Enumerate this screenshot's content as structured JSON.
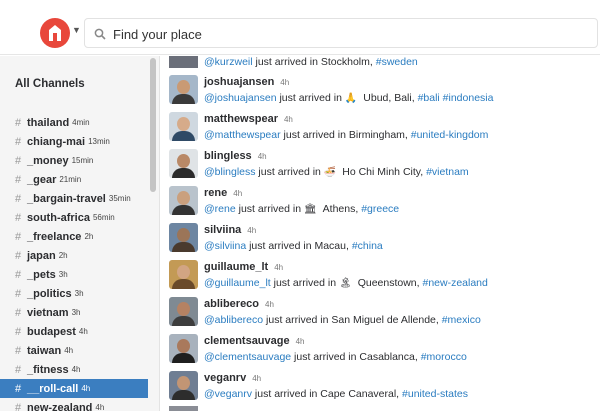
{
  "search": {
    "placeholder": "Find your place"
  },
  "sidebar": {
    "title": "All Channels",
    "channels": [
      {
        "name": "thailand",
        "time": "4min"
      },
      {
        "name": "chiang-mai",
        "time": "13min"
      },
      {
        "name": "_money",
        "time": "15min"
      },
      {
        "name": "_gear",
        "time": "21min"
      },
      {
        "name": "_bargain-travel",
        "time": "35min"
      },
      {
        "name": "south-africa",
        "time": "56min"
      },
      {
        "name": "_freelance",
        "time": "2h"
      },
      {
        "name": "japan",
        "time": "2h"
      },
      {
        "name": "_pets",
        "time": "3h"
      },
      {
        "name": "_politics",
        "time": "3h"
      },
      {
        "name": "vietnam",
        "time": "3h"
      },
      {
        "name": "budapest",
        "time": "4h"
      },
      {
        "name": "taiwan",
        "time": "4h"
      },
      {
        "name": "_fitness",
        "time": "4h"
      },
      {
        "name": "__roll-call",
        "time": "4h",
        "active": true
      },
      {
        "name": "new-zealand",
        "time": "4h"
      }
    ]
  },
  "feed": {
    "partial": {
      "mention": "@kurzweil",
      "text": " just arrived in Stockholm, ",
      "tag": "#sweden"
    },
    "messages": [
      {
        "user": "joshuajansen",
        "ago": "4h",
        "mention": "@joshuajansen",
        "text1": " just arrived in ",
        "emoji": "🙏",
        "place": "Ubud, Bali, ",
        "tags": "#bali #indonesia"
      },
      {
        "user": "matthewspear",
        "ago": "4h",
        "mention": "@matthewspear",
        "text1": " just arrived in ",
        "emoji": "",
        "place": "Birmingham, ",
        "tags": "#united-kingdom"
      },
      {
        "user": "blingless",
        "ago": "4h",
        "mention": "@blingless",
        "text1": " just arrived in ",
        "emoji": "🍜",
        "place": "Ho Chi Minh City, ",
        "tags": "#vietnam"
      },
      {
        "user": "rene",
        "ago": "4h",
        "mention": "@rene",
        "text1": " just arrived in ",
        "emoji": "🏛",
        "place": "Athens, ",
        "tags": "#greece"
      },
      {
        "user": "silviina",
        "ago": "4h",
        "mention": "@silviina",
        "text1": " just arrived in ",
        "emoji": "",
        "place": "Macau, ",
        "tags": "#china"
      },
      {
        "user": "guillaume_lt",
        "ago": "4h",
        "mention": "@guillaume_lt",
        "text1": " just arrived in ",
        "emoji": "🏝",
        "place": "Queenstown, ",
        "tags": "#new-zealand"
      },
      {
        "user": "ablibereco",
        "ago": "4h",
        "mention": "@ablibereco",
        "text1": " just arrived in ",
        "emoji": "",
        "place": "San Miguel de Allende, ",
        "tags": "#mexico"
      },
      {
        "user": "clementsauvage",
        "ago": "4h",
        "mention": "@clementsauvage",
        "text1": " just arrived in ",
        "emoji": "",
        "place": "Casablanca, ",
        "tags": "#morocco"
      },
      {
        "user": "veganrv",
        "ago": "4h",
        "mention": "@veganrv",
        "text1": " just arrived in ",
        "emoji": "",
        "place": "Cape Canaveral, ",
        "tags": "#united-states"
      }
    ]
  },
  "colors": {
    "accent": "#3b7ec0",
    "logo": "#e8473b",
    "link": "#2a7cc0"
  }
}
